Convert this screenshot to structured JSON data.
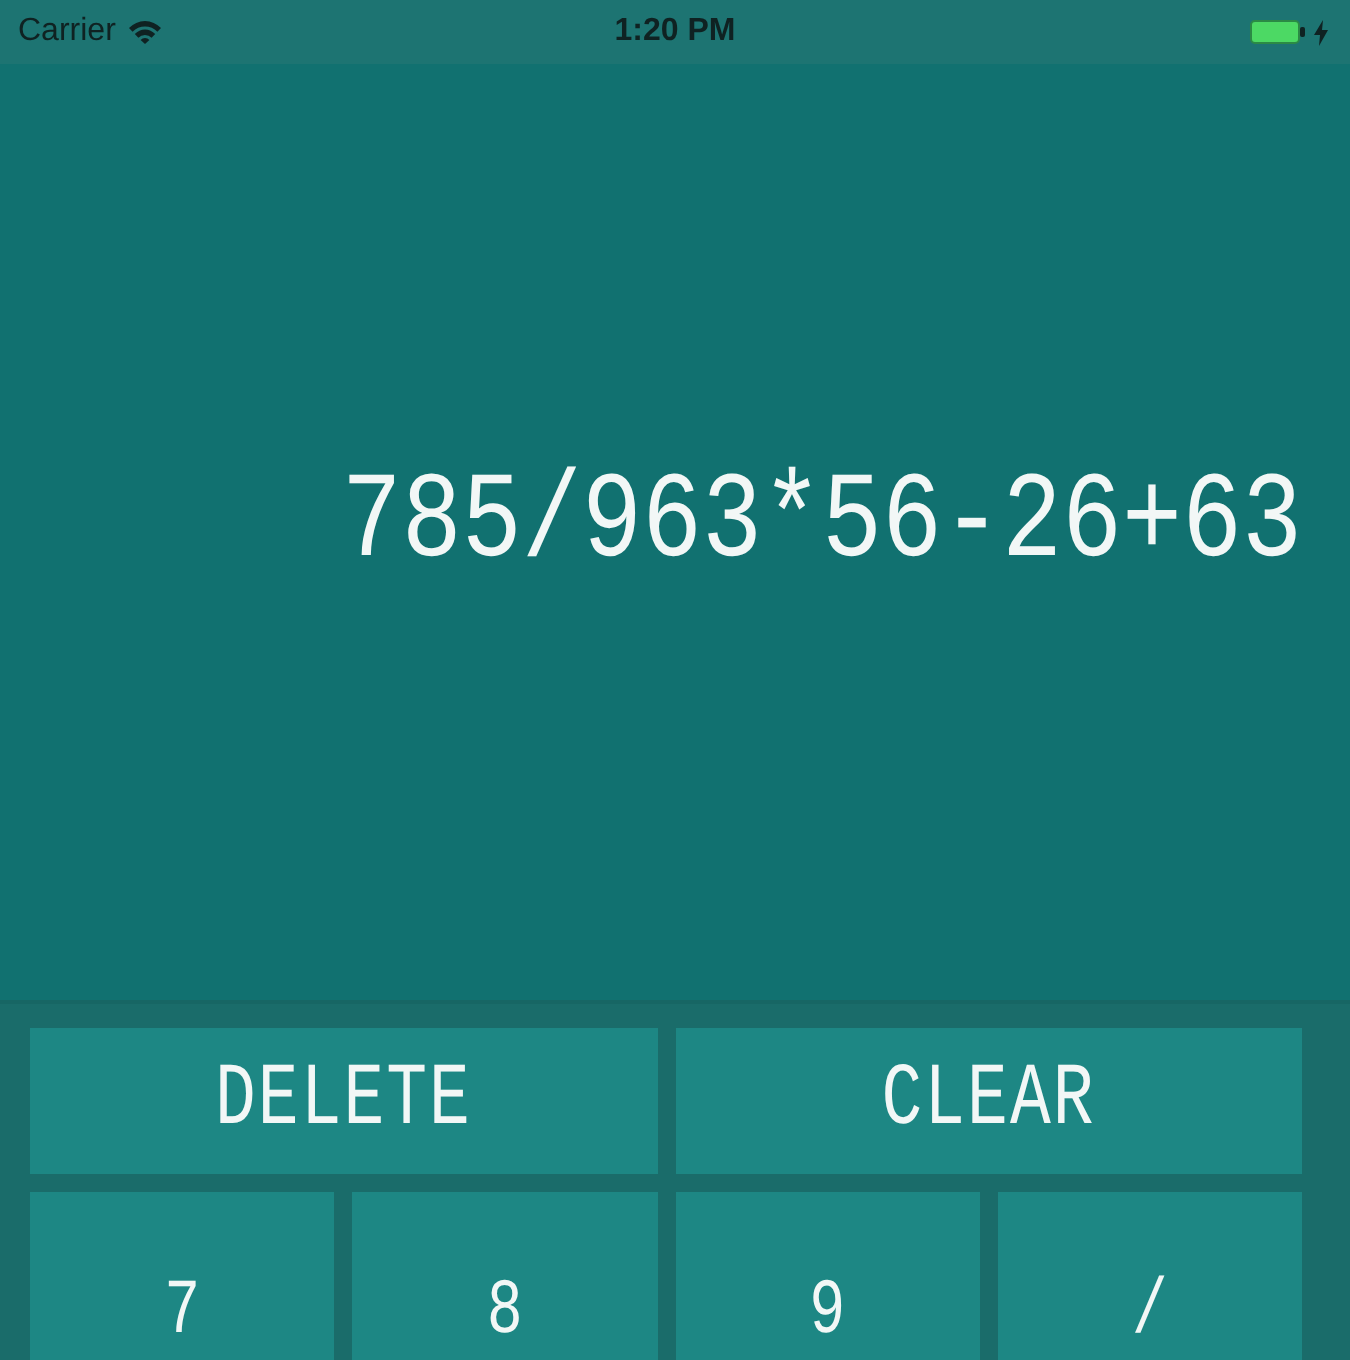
{
  "status_bar": {
    "carrier": "Carrier",
    "time": "1:20 PM",
    "charging": true
  },
  "display": {
    "expression": "785/963*56-26+63"
  },
  "keypad": {
    "rows": [
      [
        {
          "label": "DELETE"
        },
        {
          "label": "CLEAR"
        }
      ],
      [
        {
          "label": "7"
        },
        {
          "label": "8"
        },
        {
          "label": "9"
        },
        {
          "label": "/"
        }
      ]
    ]
  }
}
